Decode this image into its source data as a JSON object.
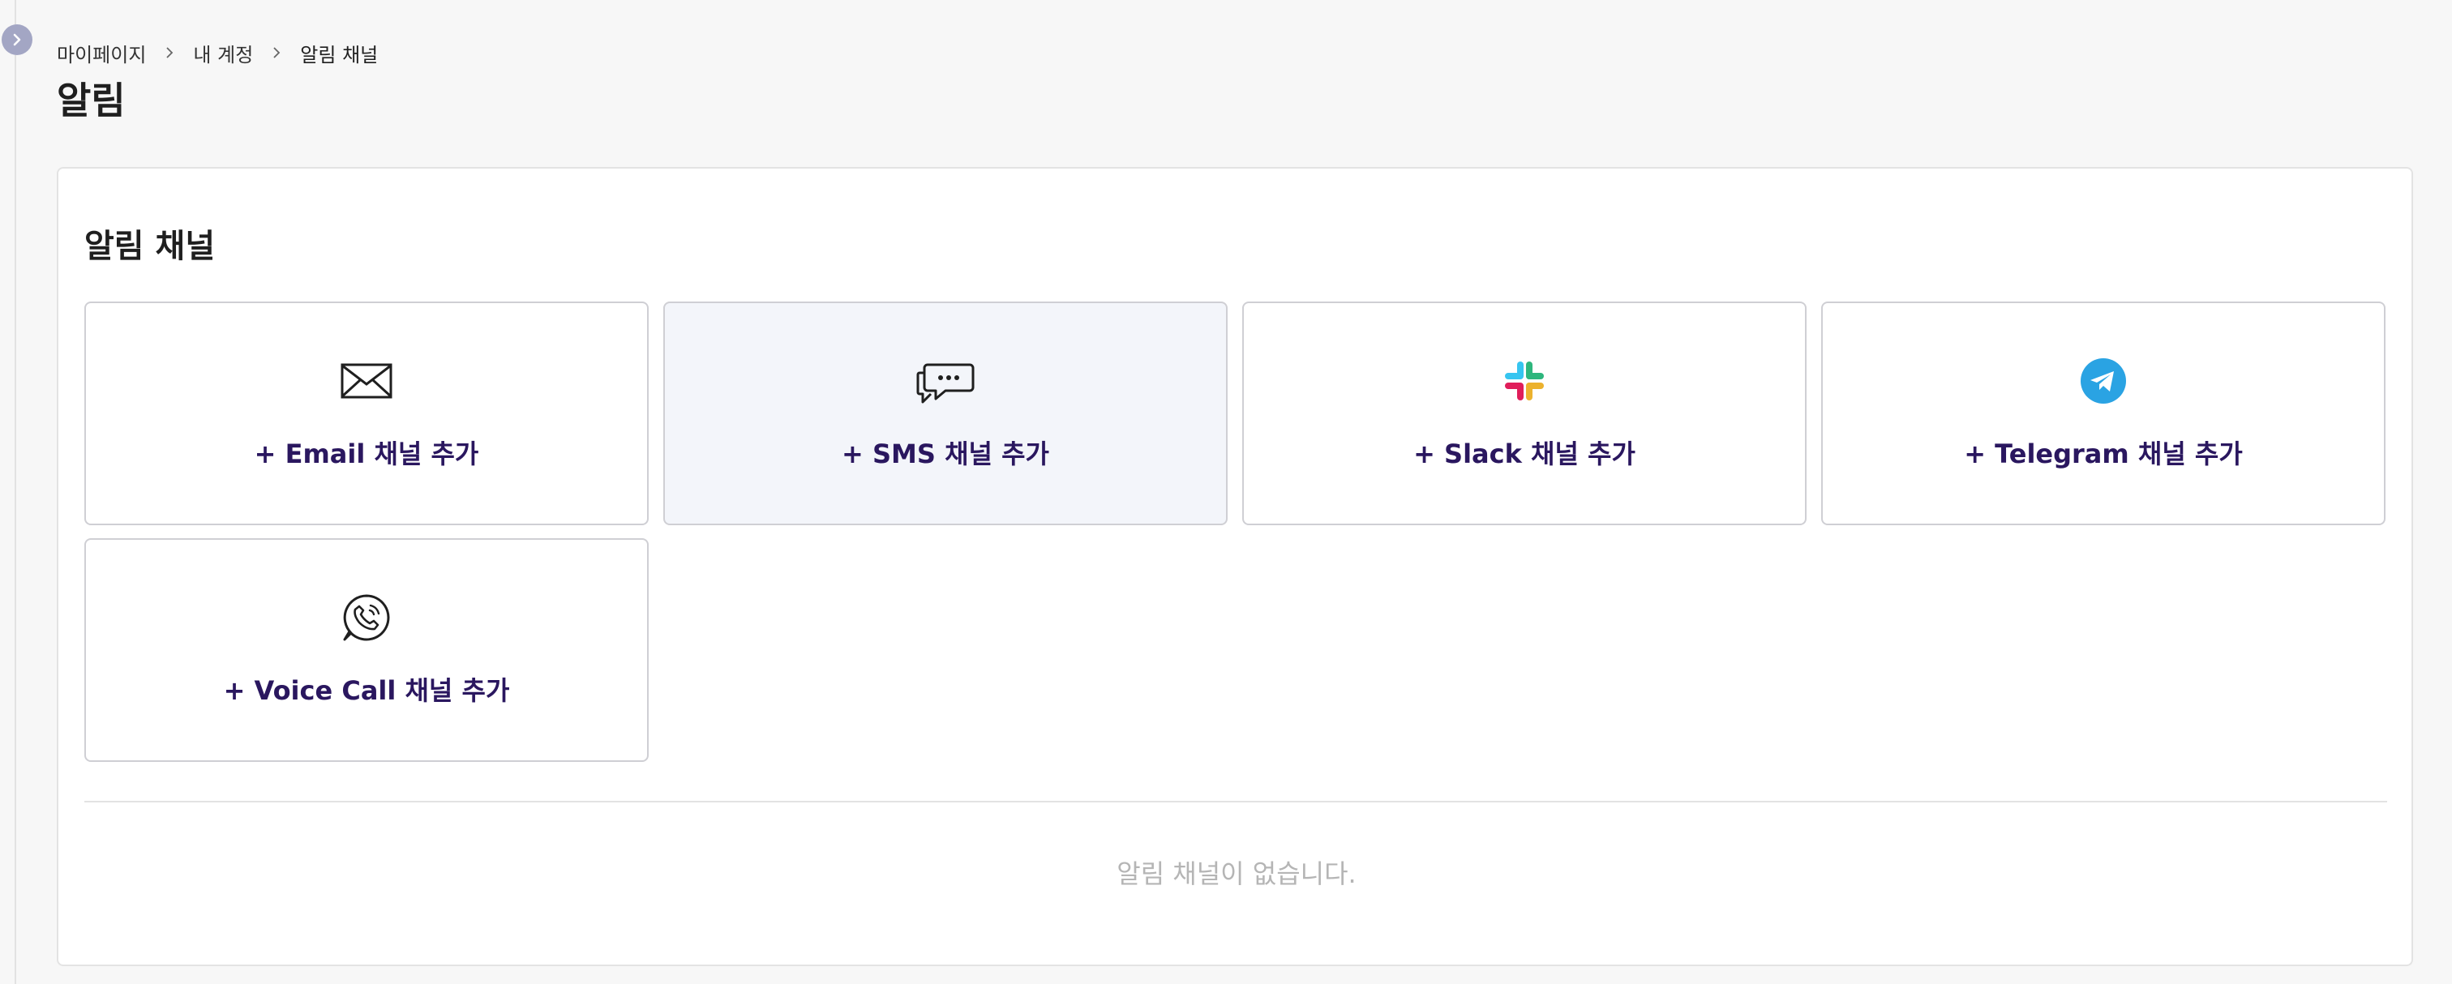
{
  "breadcrumb": {
    "items": [
      "마이페이지",
      "내 계정",
      "알림 채널"
    ]
  },
  "page": {
    "title": "알림"
  },
  "panel": {
    "section_title": "알림 채널",
    "cards": [
      {
        "label": "+ Email 채널 추가",
        "icon": "envelope-icon"
      },
      {
        "label": "+ SMS 채널 추가",
        "icon": "chat-bubble-icon"
      },
      {
        "label": "+ Slack 채널 추가",
        "icon": "slack-icon"
      },
      {
        "label": "+ Telegram 채널 추가",
        "icon": "telegram-icon"
      },
      {
        "label": "+ Voice Call 채널 추가",
        "icon": "phone-call-icon"
      }
    ],
    "empty_message": "알림 채널이 없습니다."
  },
  "colors": {
    "accent_text": "#2a175f",
    "rail_toggle": "#a3a6c4",
    "telegram_blue": "#2aa3e3",
    "slack_blue": "#36c5f0",
    "slack_green": "#2eb67d",
    "slack_red": "#e01e5a",
    "slack_yellow": "#ecb22e"
  }
}
